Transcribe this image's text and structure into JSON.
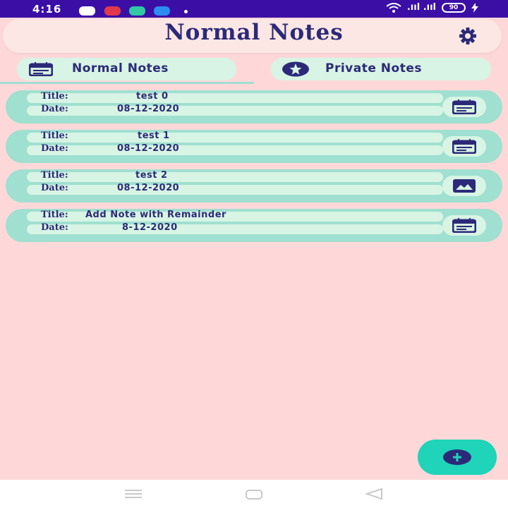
{
  "status_bar": {
    "time": "4:16",
    "signal_text": ".ııl .ııl",
    "battery_level": "90",
    "colors": {
      "background": "#3b0ea6",
      "app1": "#ffffff",
      "app2": "#e0394e",
      "app3": "#2fc9a6",
      "app4": "#2d8cf0"
    }
  },
  "header": {
    "title": "Normal Notes",
    "settings_icon": "gear-icon"
  },
  "tabs": [
    {
      "label": "Normal Notes",
      "icon": "notes-icon",
      "selected": true
    },
    {
      "label": "Private Notes",
      "icon": "star-icon",
      "selected": false
    }
  ],
  "notes": [
    {
      "title_label": "Title:",
      "title": "test 0",
      "date_label": "Date:",
      "date": "08-12-2020",
      "icon": "note-list-icon"
    },
    {
      "title_label": "Title:",
      "title": "test 1",
      "date_label": "Date:",
      "date": "08-12-2020",
      "icon": "note-list-icon"
    },
    {
      "title_label": "Title:",
      "title": "test 2",
      "date_label": "Date:",
      "date": "08-12-2020",
      "icon": "image-icon"
    },
    {
      "title_label": "Title:",
      "title": "Add Note with Remainder",
      "date_label": "Date:",
      "date": "8-12-2020",
      "icon": "note-list-icon"
    }
  ],
  "fab": {
    "icon": "plus-icon"
  },
  "nav_bar": {
    "buttons": [
      "menu-icon",
      "home-icon",
      "back-icon"
    ]
  },
  "theme": {
    "background": "#fed8d9",
    "card": "#9fe0d0",
    "pill": "#d8f4e4",
    "text": "#2c2a78",
    "fab": "#1fd4b8"
  }
}
